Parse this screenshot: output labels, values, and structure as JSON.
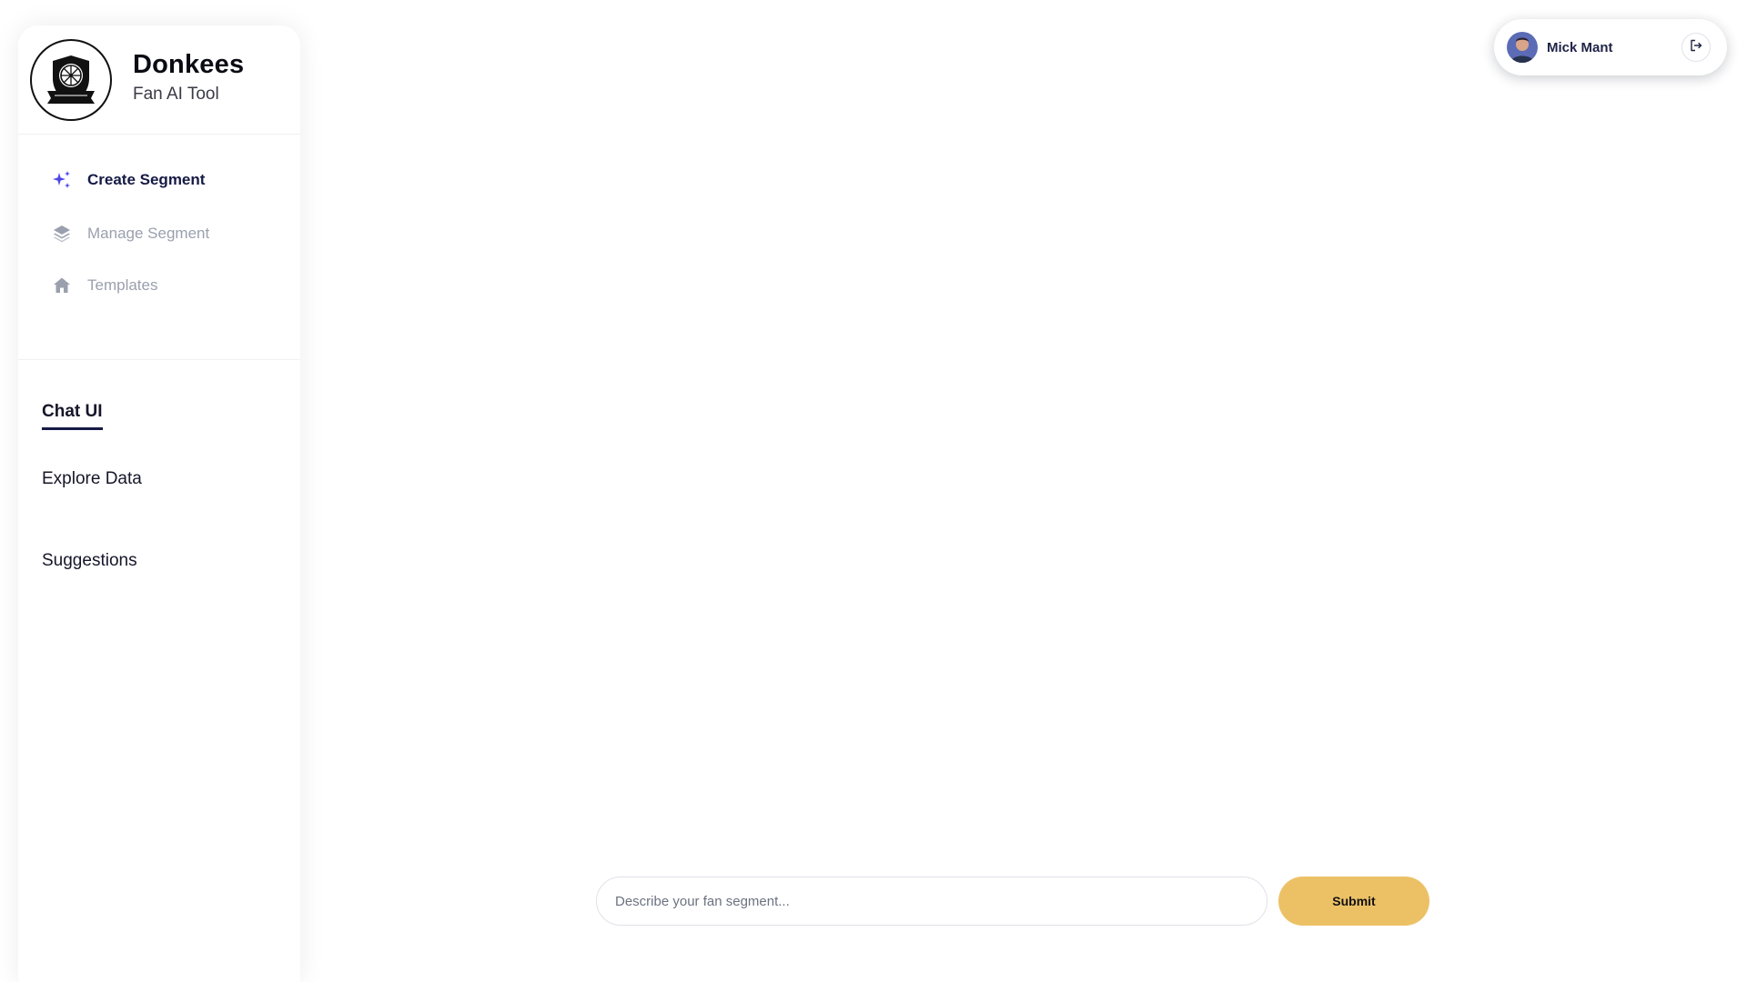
{
  "brand": {
    "name": "Donkees",
    "subtitle": "Fan AI Tool"
  },
  "nav": {
    "items": [
      {
        "label": "Create Segment",
        "icon": "sparkles-icon",
        "active": true
      },
      {
        "label": "Manage Segment",
        "icon": "layers-icon",
        "active": false
      },
      {
        "label": "Templates",
        "icon": "home-icon",
        "active": false
      }
    ]
  },
  "tabs": [
    {
      "label": "Chat UI",
      "active": true
    },
    {
      "label": "Explore Data",
      "active": false
    },
    {
      "label": "Suggestions",
      "active": false
    }
  ],
  "user": {
    "name": "Mick Mant",
    "logout_icon": "logout-icon"
  },
  "composer": {
    "placeholder": "Describe your fan segment...",
    "value": "",
    "submit_label": "Submit"
  },
  "colors": {
    "accent_navy": "#151a45",
    "active_icon": "#4f46e5",
    "inactive": "#9aa0ad",
    "submit": "#ecc166"
  }
}
